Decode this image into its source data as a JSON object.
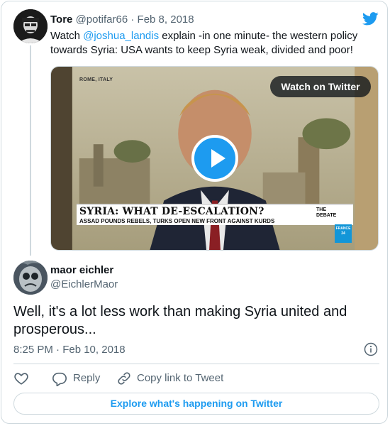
{
  "quoted_tweet": {
    "author_name": "Tore",
    "author_handle": "@potifar66",
    "separator": "·",
    "date": "Feb 8, 2018",
    "text_prefix": "Watch ",
    "mention": "@joshua_landis",
    "text_suffix": "  explain -in one minute- the western policy towards Syria: USA wants to keep Syria weak, divided and poor!",
    "media": {
      "location_label": "ROME, ITALY",
      "watch_button_label": "Watch on Twitter",
      "headline": "SYRIA: WHAT DE-ESCALATION?",
      "subheadline": "ASSAD POUNDS REBELS, TURKS OPEN NEW FRONT AGAINST KURDS",
      "show_logo_line1": "THE",
      "show_logo_line2": "DEBATE",
      "channel_logo_line1": "FRANCE",
      "channel_logo_line2": "24"
    }
  },
  "reply_tweet": {
    "author_name": "maor eichler",
    "author_handle": "@EichlerMaor",
    "text": "Well, it's a lot less work than making Syria united and prosperous...",
    "timestamp": "8:25 PM · Feb 10, 2018"
  },
  "actions": {
    "like_icon": "heart-icon",
    "reply_label": "Reply",
    "copy_link_label": "Copy link to Tweet"
  },
  "explore_label": "Explore what's happening on Twitter",
  "colors": {
    "accent": "#1d9bf0",
    "text": "#0f1419",
    "secondary_text": "#536471",
    "border": "#cfd9de"
  }
}
